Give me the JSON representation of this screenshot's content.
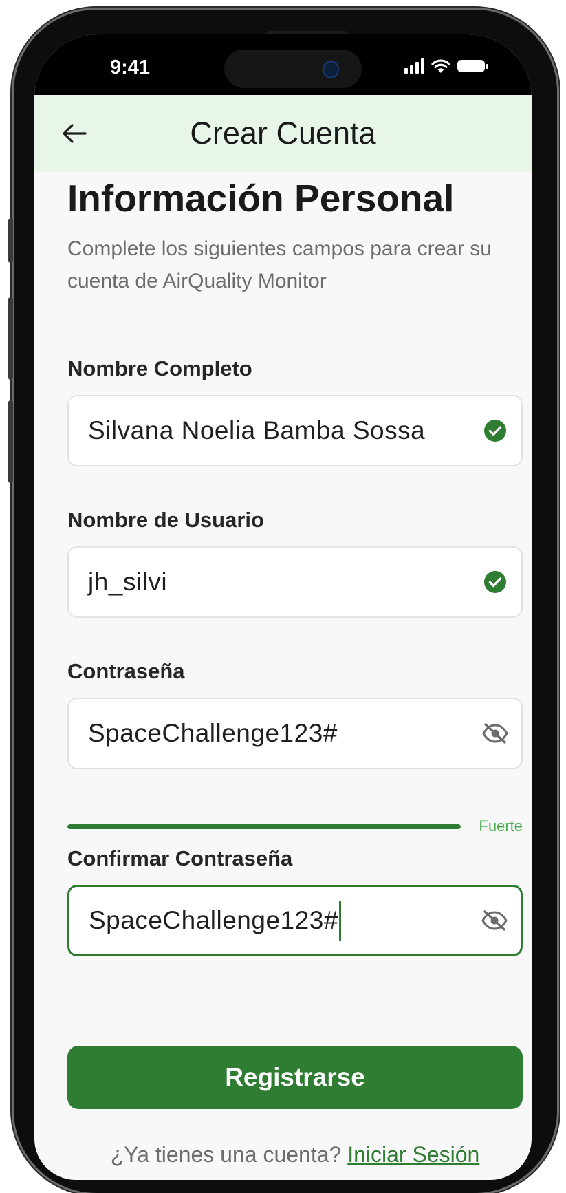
{
  "status_bar": {
    "time": "9:41"
  },
  "app_bar": {
    "title": "Crear Cuenta"
  },
  "form": {
    "section_title": "Información Personal",
    "subtitle": "Complete los siguientes campos para crear su cuenta de AirQuality Monitor",
    "full_name": {
      "label": "Nombre Completo",
      "value": "Silvana Noelia Bamba Sossa",
      "valid": true
    },
    "username": {
      "label": "Nombre de Usuario",
      "value": "jh_silvi",
      "valid": true
    },
    "password": {
      "label": "Contraseña",
      "value": "SpaceChallenge123#",
      "strength_label": "Fuerte",
      "strength_percent": 100
    },
    "confirm_password": {
      "label": "Confirmar Contraseña",
      "value": "SpaceChallenge123#",
      "focused": true
    },
    "submit_label": "Registrarse",
    "login_prompt": "¿Ya tienes una cuenta?",
    "login_link": "Iniciar Sesión"
  },
  "icons": {
    "back": "arrow-left-icon",
    "valid": "check-circle-icon",
    "visibility": "eye-off-icon"
  },
  "colors": {
    "primary": "#2e7d32",
    "app_bar_bg": "#e8f5e9",
    "valid_check": "#2e7d32",
    "strength": "#2e7d32"
  }
}
